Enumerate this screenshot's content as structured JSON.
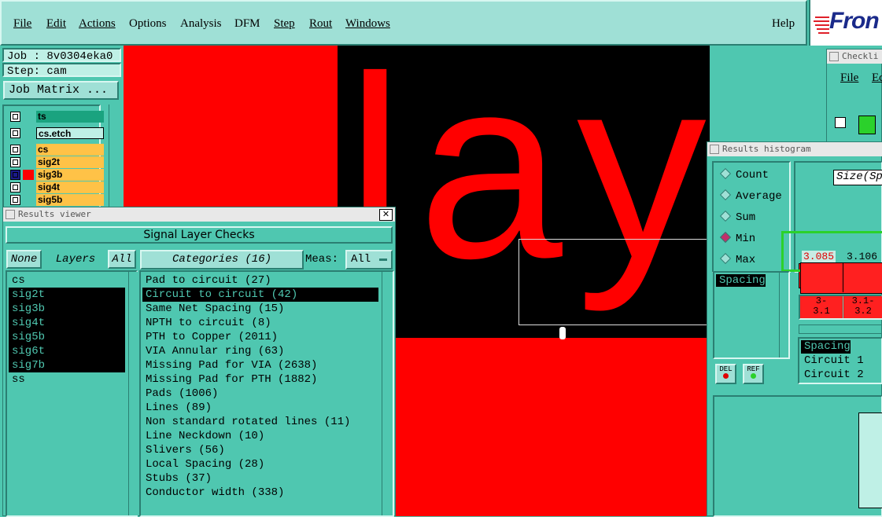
{
  "menubar": {
    "items": [
      {
        "label": "File",
        "key": "menu-file"
      },
      {
        "label": "Edit",
        "key": "menu-edit"
      },
      {
        "label": "Actions",
        "key": "menu-actions"
      },
      {
        "label": "Options",
        "key": "menu-options"
      },
      {
        "label": "Analysis",
        "key": "menu-analysis"
      },
      {
        "label": "DFM",
        "key": "menu-dfm"
      },
      {
        "label": "Step",
        "key": "menu-step"
      },
      {
        "label": "Rout",
        "key": "menu-rout"
      },
      {
        "label": "Windows",
        "key": "menu-windows"
      }
    ],
    "help": "Help"
  },
  "logo": {
    "text": "Fron"
  },
  "job": {
    "job_label": "Job : 8v0304eka0",
    "step_label": "Step: cam",
    "matrix_button": "Job Matrix ..."
  },
  "layers": [
    {
      "name": "ts",
      "color": "#1aa37f"
    },
    {
      "name": "cs.etch",
      "color": "#bff0e6"
    },
    {
      "name": "cs",
      "color": "#ffc247"
    },
    {
      "name": "sig2t",
      "color": "#ffc247"
    },
    {
      "name": "sig3b",
      "color": "#ffc247"
    },
    {
      "name": "sig4t",
      "color": "#ffc247"
    },
    {
      "name": "sig5b",
      "color": "#ffc247"
    }
  ],
  "results_viewer": {
    "title": "Results viewer",
    "heading": "Signal Layer Checks",
    "none_button": "None",
    "layers_label": "Layers",
    "all_button": "All",
    "categories_label": "Categories (16)",
    "meas_label": "Meas:",
    "meas_value": "All",
    "layer_list": [
      {
        "name": "cs",
        "selected": false
      },
      {
        "name": "sig2t",
        "selected": true
      },
      {
        "name": "sig3b",
        "selected": true
      },
      {
        "name": "sig4t",
        "selected": true
      },
      {
        "name": "sig5b",
        "selected": true
      },
      {
        "name": "sig6t",
        "selected": true
      },
      {
        "name": "sig7b",
        "selected": true
      },
      {
        "name": "ss",
        "selected": false
      }
    ],
    "categories": [
      {
        "name": "Pad to circuit (27)",
        "selected": false
      },
      {
        "name": "Circuit to circuit (42)",
        "selected": true
      },
      {
        "name": "Same Net Spacing (15)",
        "selected": false
      },
      {
        "name": "NPTH to circuit (8)",
        "selected": false
      },
      {
        "name": "PTH to Copper (2011)",
        "selected": false
      },
      {
        "name": "VIA Annular ring (63)",
        "selected": false
      },
      {
        "name": "Missing Pad for VIA (2638)",
        "selected": false
      },
      {
        "name": "Missing Pad for PTH (1882)",
        "selected": false
      },
      {
        "name": "Pads (1006)",
        "selected": false
      },
      {
        "name": "Lines (89)",
        "selected": false
      },
      {
        "name": "Non standard rotated lines (11)",
        "selected": false
      },
      {
        "name": "Line Neckdown (10)",
        "selected": false
      },
      {
        "name": "Slivers (56)",
        "selected": false
      },
      {
        "name": "Local Spacing (28)",
        "selected": false
      },
      {
        "name": "Stubs (37)",
        "selected": false
      },
      {
        "name": "Conductor width (338)",
        "selected": false
      }
    ]
  },
  "histogram": {
    "title": "Results histogram",
    "options": [
      {
        "label": "Count",
        "selected": false
      },
      {
        "label": "Average",
        "selected": false
      },
      {
        "label": "Sum",
        "selected": false
      },
      {
        "label": "Min",
        "selected": true
      },
      {
        "label": "Max",
        "selected": false
      }
    ],
    "size_label": "Size(Sp",
    "spacing_item": "Spacing",
    "values": [
      "3.085",
      "3.106"
    ],
    "bins": [
      "3-\n3.1",
      "3.1-\n3.2"
    ],
    "del_label": "DEL",
    "ref_label": "REF",
    "detail": [
      "Spacing",
      "Circuit 1",
      "Circuit 2"
    ]
  },
  "checklist": {
    "title": "Checkli",
    "menu_file": "File",
    "menu_edit": "Ed"
  },
  "canvas": {
    "text": "laye"
  },
  "colors": {
    "accent": "#4fc7b0",
    "copper": "#ff0000",
    "highlight_green": "#2bd12b"
  }
}
